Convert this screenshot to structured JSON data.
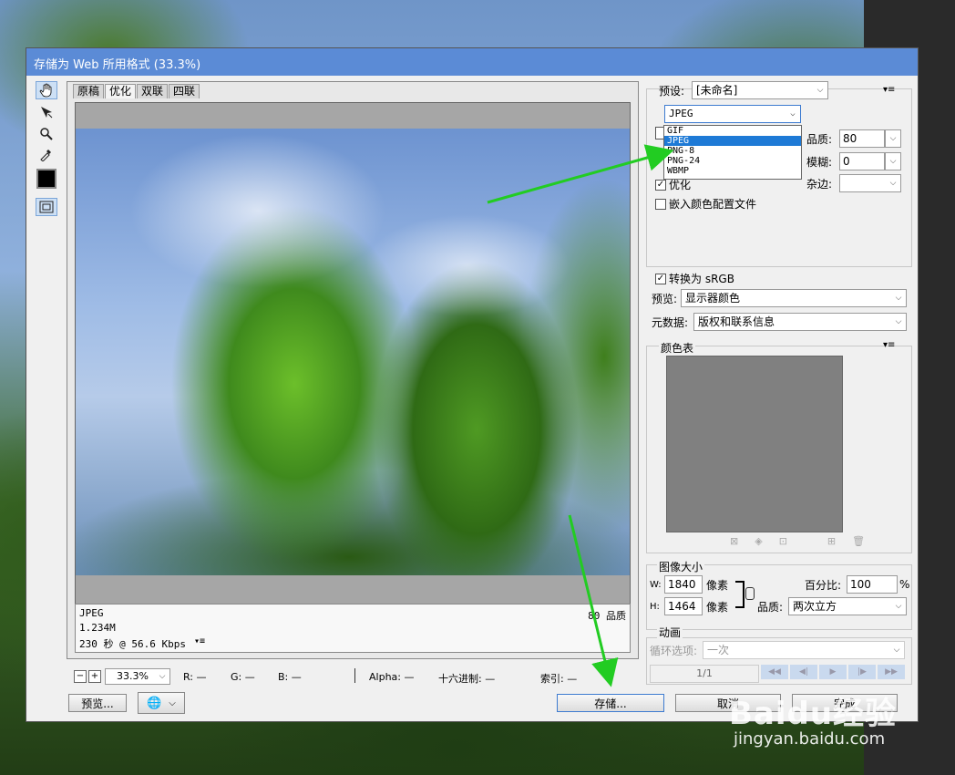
{
  "title": "存储为 Web 所用格式 (33.3%)",
  "tabs": [
    "原稿",
    "优化",
    "双联",
    "四联"
  ],
  "active_tab": 1,
  "info": {
    "format": "JPEG",
    "size": "1.234M",
    "download": "230 秒 @ 56.6 Kbps",
    "quality": "80 品质"
  },
  "zoom": "33.3%",
  "readouts": {
    "r": "R: —",
    "g": "G: —",
    "b": "B: —",
    "alpha": "Alpha: —",
    "hex": "十六进制: —",
    "index": "索引: —"
  },
  "buttons": {
    "preview": "预览...",
    "save": "存储...",
    "cancel": "取消",
    "done": "完成"
  },
  "preset": {
    "label": "预设:",
    "value": "[未命名]"
  },
  "format_select": "JPEG",
  "format_options": [
    "GIF",
    "JPEG",
    "PNG-8",
    "PNG-24",
    "WBMP"
  ],
  "format_selected_index": 1,
  "quality": {
    "label": "品质:",
    "value": "80"
  },
  "blur": {
    "label": "模糊:",
    "value": "0"
  },
  "matte": {
    "label": "杂边:",
    "value": ""
  },
  "optimize": "优化",
  "embed_profile": "嵌入颜色配置文件",
  "convert_srgb": "转换为 sRGB",
  "preview_row": {
    "label": "预览:",
    "value": "显示器颜色"
  },
  "metadata_row": {
    "label": "元数据:",
    "value": "版权和联系信息"
  },
  "color_table": "颜色表",
  "image_size": {
    "title": "图像大小",
    "w_label": "W:",
    "w_value": "1840",
    "h_label": "H:",
    "h_value": "1464",
    "unit": "像素",
    "percent_label": "百分比:",
    "percent_value": "100",
    "percent_unit": "%",
    "quality_label": "品质:",
    "quality_value": "两次立方"
  },
  "animation": {
    "title": "动画",
    "loop_label": "循环选项:",
    "loop_value": "一次",
    "frame": "1/1"
  },
  "watermark": {
    "brand": "Baidu经验",
    "url": "jingyan.baidu.com"
  },
  "colors": {
    "titlebar": "#5b8bd6",
    "selection": "#1e7ad6",
    "arrow": "#22cc22"
  }
}
